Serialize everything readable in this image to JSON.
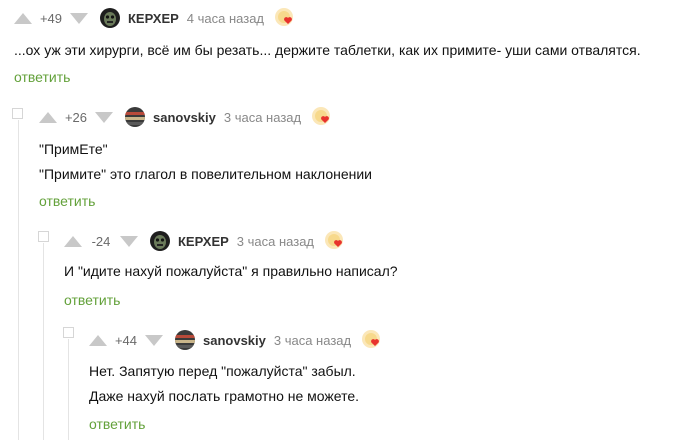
{
  "comments": [
    {
      "rating": "+49",
      "author": "КЕРХЕР",
      "time": "4 часа назад",
      "lines": [
        "...ох уж эти хирурги, всё им бы резать... держите таблетки, как их примите- уши сами отвалятся."
      ],
      "reply_label": "ответить"
    },
    {
      "rating": "+26",
      "author": "sanovskiy",
      "time": "3 часа назад",
      "lines": [
        "\"ПримЕте\"",
        "\"Примите\" это глагол в повелительном наклонении"
      ],
      "reply_label": "ответить"
    },
    {
      "rating": "-24",
      "author": "КЕРХЕР",
      "time": "3 часа назад",
      "lines": [
        "И \"идите нахуй пожалуйста\" я правильно написал?"
      ],
      "reply_label": "ответить"
    },
    {
      "rating": "+44",
      "author": "sanovskiy",
      "time": "3 часа назад",
      "lines": [
        "Нет. Запятую перед \"пожалуйста\" забыл.",
        "Даже нахуй послать грамотно не можете."
      ],
      "reply_label": "ответить"
    }
  ],
  "icons": {
    "vote_up": "triangle-up-icon",
    "vote_down": "triangle-down-icon",
    "badge": "heart-badge-icon"
  },
  "colors": {
    "reply_link": "#63a13a",
    "vote_arrow": "#c8c8c8",
    "thread_line": "#e4e4e4"
  }
}
